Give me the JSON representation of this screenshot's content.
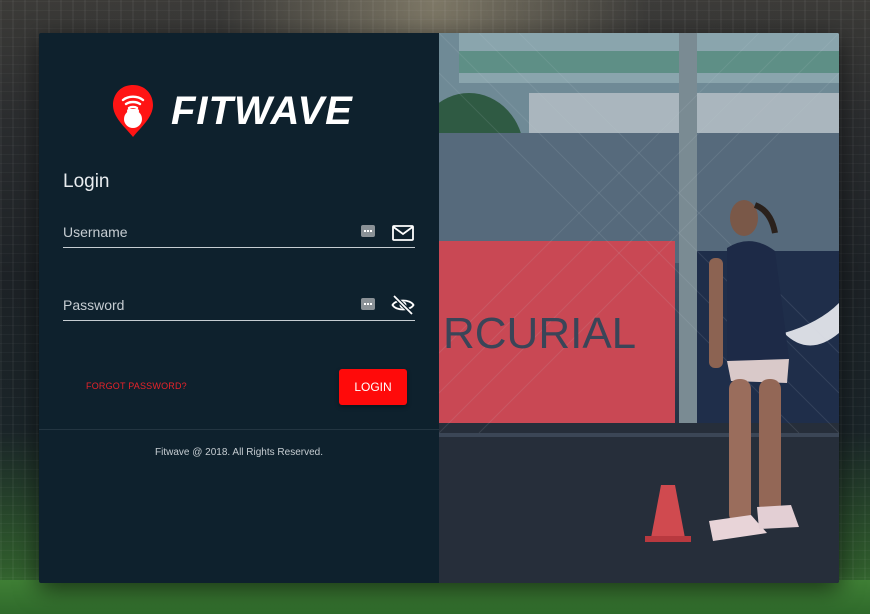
{
  "brand": {
    "name": "FITWAVE",
    "logo_icon": "kettlebell-wifi-pin-icon",
    "accent_color": "#ff0a0a"
  },
  "login_form": {
    "title": "Login",
    "username_placeholder": "Username",
    "username_icon": "mail-icon",
    "password_placeholder": "Password",
    "password_icon": "eye-off-icon",
    "autofill_icon": "password-manager-icon",
    "forgot_password_label": "FORGOT PASSWORD?",
    "login_button_label": "LOGIN"
  },
  "footer": {
    "copyright": "Fitwave @ 2018. All Rights Reserved."
  },
  "hero_image": {
    "banner_text": "RCURIAL"
  },
  "colors": {
    "panel_background": "#0e212d",
    "forgot_link": "#e8232a",
    "button": "#ff0a0a"
  }
}
